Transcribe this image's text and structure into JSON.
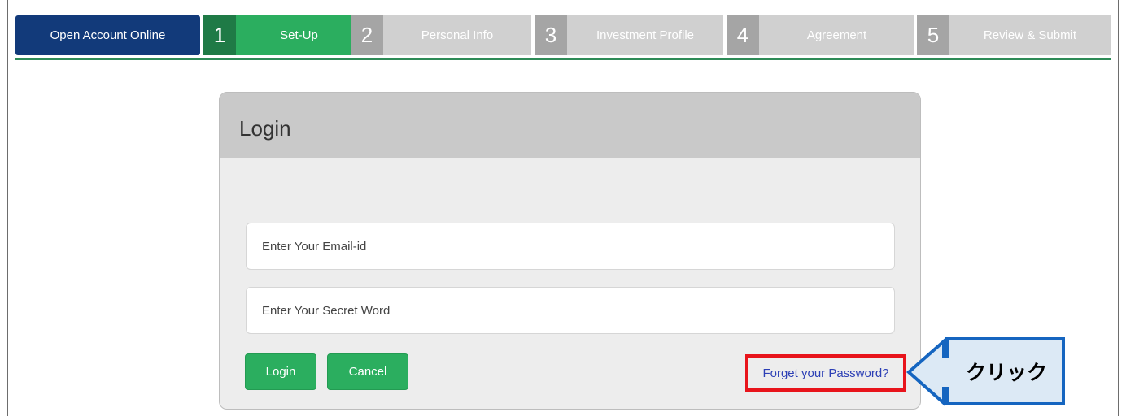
{
  "steps": {
    "open_label": "Open Account Online",
    "items": [
      {
        "num": "1",
        "label": "Set-Up"
      },
      {
        "num": "2",
        "label": "Personal Info"
      },
      {
        "num": "3",
        "label": "Investment Profile"
      },
      {
        "num": "4",
        "label": "Agreement"
      },
      {
        "num": "5",
        "label": "Review & Submit"
      }
    ]
  },
  "login": {
    "title": "Login",
    "email_placeholder": "Enter Your Email-id",
    "secret_placeholder": "Enter Your Secret Word",
    "login_button": "Login",
    "cancel_button": "Cancel",
    "forgot_link": "Forget your Password?"
  },
  "annotation": {
    "text": "クリック"
  },
  "colors": {
    "open_bg": "#123a7a",
    "active_num": "#1f7a46",
    "active_label": "#2bae5f",
    "inactive_num": "#a5a5a5",
    "inactive_label": "#d0d0d0",
    "highlight": "#e8141b",
    "callout_border": "#1565c0",
    "callout_fill": "#dce9f5"
  }
}
